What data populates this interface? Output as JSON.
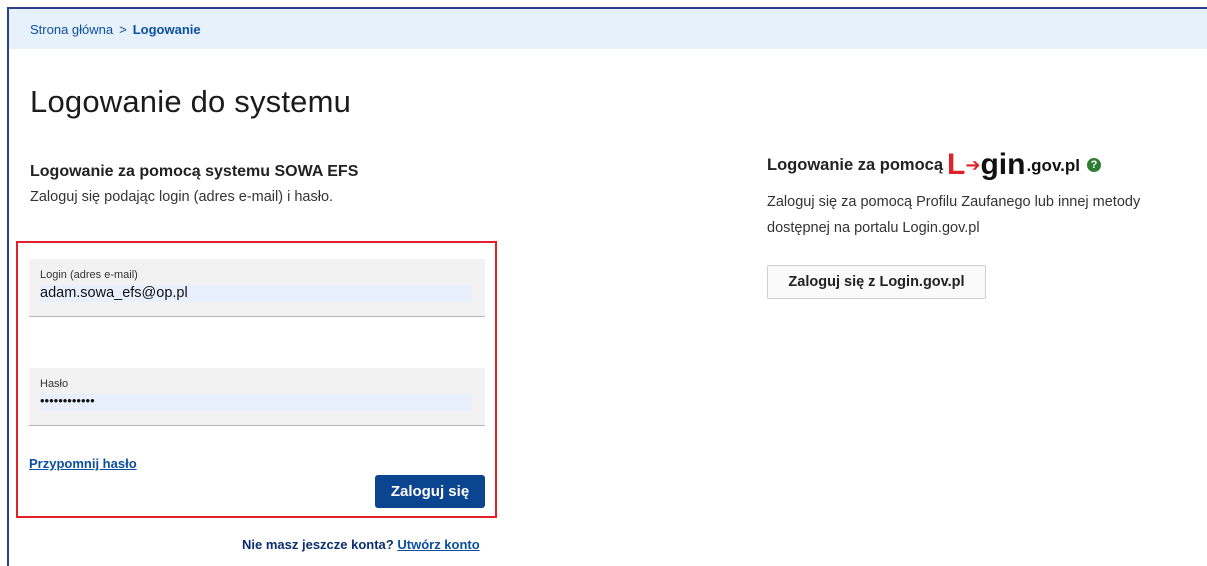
{
  "breadcrumb": {
    "home": "Strona główna",
    "separator": ">",
    "current": "Logowanie"
  },
  "page": {
    "title": "Logowanie do systemu"
  },
  "sowa_login": {
    "heading": "Logowanie za pomocą systemu SOWA EFS",
    "description": "Zaloguj się podając login (adres e-mail) i hasło.",
    "login_label": "Login (adres e-mail)",
    "login_value": "adam.sowa_efs@op.pl",
    "password_label": "Hasło",
    "password_value": "••••••••••••",
    "remind_link": "Przypomnij hasło",
    "submit_label": "Zaloguj się"
  },
  "register": {
    "prompt": "Nie masz jeszcze konta?",
    "link": "Utwórz konto"
  },
  "logingov": {
    "heading_prefix": "Logowanie za pomocą",
    "logo_L": "L",
    "logo_arrow": "➔",
    "logo_gin": "gin",
    "logo_domain": ".gov.pl",
    "help_icon_glyph": "?",
    "description_line1": "Zaloguj się za pomocą Profilu Zaufanego lub innej metody",
    "description_line2": "dostępnej na portalu Login.gov.pl",
    "button_label": "Zaloguj się z Login.gov.pl"
  },
  "colors": {
    "accent": "#0b4590",
    "breadcrumb_bg": "#e6f1fb",
    "highlight_border": "#e0212b",
    "logo_red": "#e0212b",
    "help_green": "#2e7d32"
  }
}
